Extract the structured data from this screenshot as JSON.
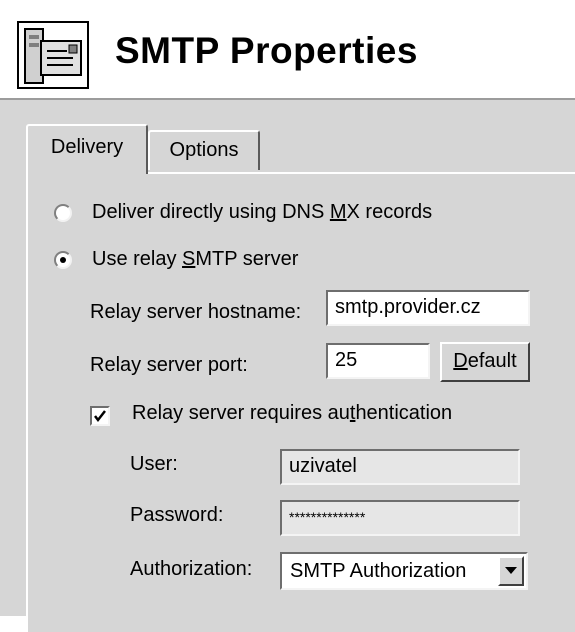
{
  "window": {
    "title": "SMTP Properties",
    "icon": "mail-server-icon"
  },
  "tabs": [
    {
      "label": "Delivery",
      "selected": true
    },
    {
      "label": "Options",
      "selected": false
    }
  ],
  "delivery": {
    "dns_mx": {
      "label_before": "Deliver directly using DNS ",
      "label_accel": "M",
      "label_after": "X records",
      "selected": false
    },
    "relay": {
      "label_before": "Use relay ",
      "label_accel": "S",
      "label_after": "MTP server",
      "selected": true
    },
    "hostname": {
      "label": "Relay server hostname:",
      "value": "smtp.provider.cz"
    },
    "port": {
      "label": "Relay server port:",
      "value": "25"
    },
    "default_button": {
      "accel": "D",
      "rest": "efault"
    },
    "auth_check": {
      "label_before": "Relay server requires au",
      "label_accel": "t",
      "label_after": "hentication",
      "checked": true
    },
    "user": {
      "label": "User:",
      "value": "uzivatel"
    },
    "password": {
      "label": "Password:",
      "value": "**************"
    },
    "authorization": {
      "label": "Authorization:",
      "value": "SMTP Authorization"
    }
  },
  "colors": {
    "dialog_bg": "#d6d6d6",
    "field_bg": "#ffffff",
    "disabled_field_bg": "#e6e6e6"
  }
}
